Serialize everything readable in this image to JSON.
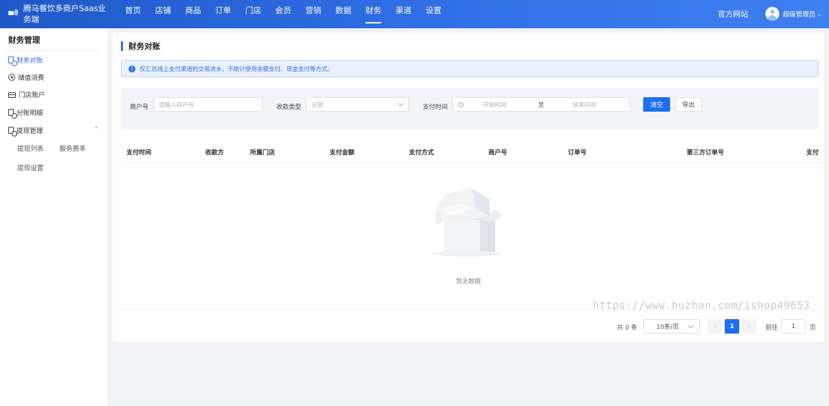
{
  "header": {
    "brand": "腾马餐饮多商户Saas业务端",
    "nav": [
      "首页",
      "店铺",
      "商品",
      "订单",
      "门店",
      "会员",
      "营销",
      "数据",
      "财务",
      "渠道",
      "设置"
    ],
    "active_nav": "财务",
    "official_site": "官方网站",
    "user_name": "超级管理员",
    "user_caret": "⌄"
  },
  "sidebar": {
    "title": "财务管理",
    "items": [
      {
        "label": "财务对账",
        "icon": "document-coin-icon",
        "active": true
      },
      {
        "label": "储值消费",
        "icon": "play-circle-icon",
        "active": false
      },
      {
        "label": "门店账户",
        "icon": "card-icon",
        "active": false
      },
      {
        "label": "分账明细",
        "icon": "document-coin-icon",
        "active": false
      },
      {
        "label": "提现管理",
        "icon": "document-coin-icon",
        "active": false,
        "expanded": true
      }
    ],
    "group_caret": "⌃",
    "sub_items": [
      "提现列表",
      "服务费率",
      "提现设置"
    ]
  },
  "main": {
    "page_title": "财务对账",
    "alert": {
      "icon": "!",
      "text": "仅汇总线上支付渠道的交易流水，不统计使用余额支付、现金支付等方式。"
    },
    "filter": {
      "merchant_label": "商户号",
      "merchant_placeholder": "请输入商户号",
      "type_label": "收款类型",
      "type_value": "全部",
      "time_label": "支付时间",
      "start_placeholder": "开始时间",
      "range_sep": "至",
      "end_placeholder": "结束时间",
      "clear_button": "清空",
      "export_button": "导出"
    },
    "table": {
      "columns": [
        "支付时间",
        "收款方",
        "所属门店",
        "支付金额",
        "支付方式",
        "商户号",
        "订单号",
        "第三方订单号",
        "支付"
      ],
      "rows": [],
      "empty_text": "暂无数据"
    },
    "pagination": {
      "total": "共 0 条",
      "page_size": "10条/页",
      "prev": "‹",
      "current": "1",
      "next": "›",
      "goto_label": "前往",
      "goto_value": "1",
      "page_unit": "页"
    }
  },
  "watermark": "https://www.huzhan.com/ishop49653"
}
